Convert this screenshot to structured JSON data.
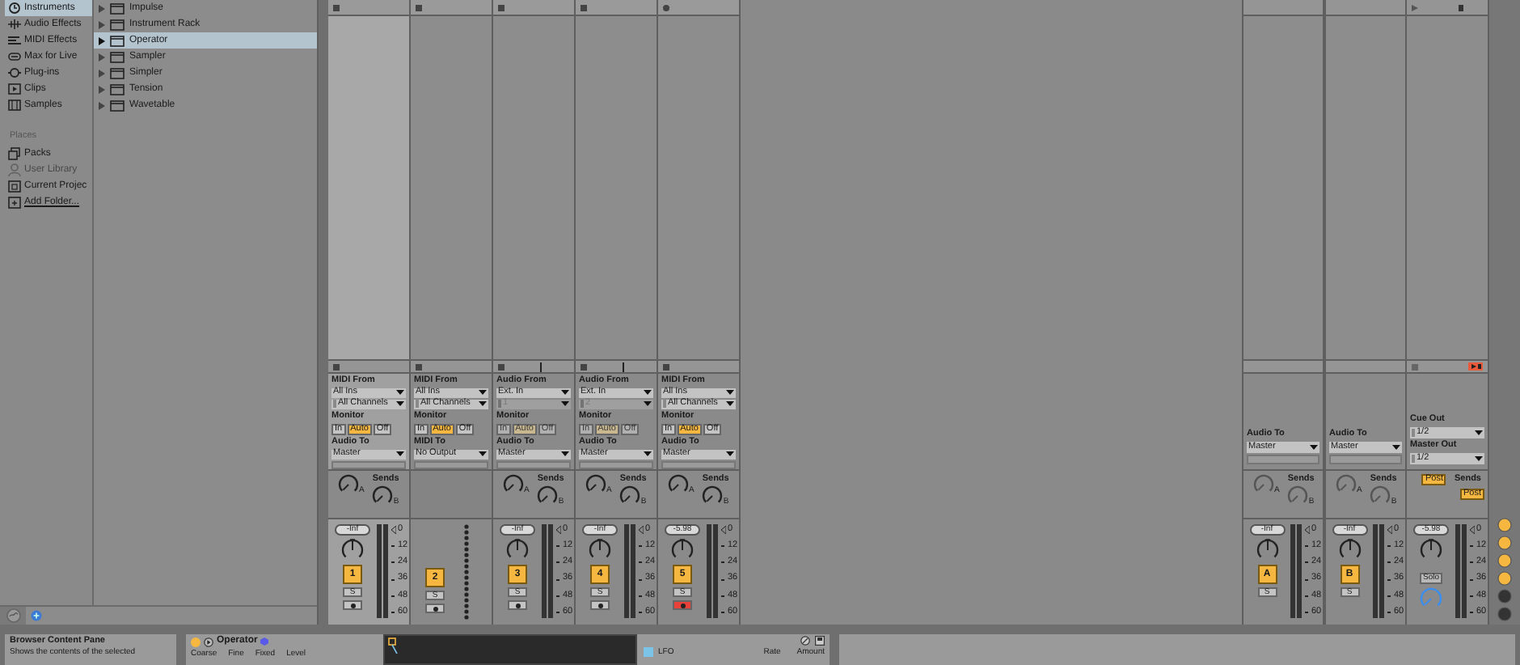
{
  "browser": {
    "categories": [
      {
        "label": "Instruments",
        "selected": true
      },
      {
        "label": "Audio Effects",
        "selected": false
      },
      {
        "label": "MIDI Effects",
        "selected": false
      },
      {
        "label": "Max for Live",
        "selected": false
      },
      {
        "label": "Plug-ins",
        "selected": false
      },
      {
        "label": "Clips",
        "selected": false
      },
      {
        "label": "Samples",
        "selected": false
      }
    ],
    "places_title": "Places",
    "places": [
      {
        "label": "Packs",
        "disabled": false
      },
      {
        "label": "User Library",
        "disabled": true
      },
      {
        "label": "Current Projec",
        "disabled": false
      },
      {
        "label": "Add Folder...",
        "disabled": false
      }
    ],
    "items": [
      {
        "label": "Impulse",
        "selected": false
      },
      {
        "label": "Instrument Rack",
        "selected": false
      },
      {
        "label": "Operator",
        "selected": true
      },
      {
        "label": "Sampler",
        "selected": false
      },
      {
        "label": "Simpler",
        "selected": false
      },
      {
        "label": "Tension",
        "selected": false
      },
      {
        "label": "Wavetable",
        "selected": false
      }
    ]
  },
  "tracks": [
    {
      "kind": "midi",
      "selected": true,
      "armed": false,
      "input_title": "MIDI From",
      "input": "All Ins",
      "channel": "All Channels",
      "channel_disabled": false,
      "monitor_title": "Monitor",
      "monitor_disabled": false,
      "monitor": [
        {
          "label": "In",
          "selected": false
        },
        {
          "label": "Auto",
          "selected": true
        },
        {
          "label": "Off",
          "selected": false
        }
      ],
      "output_title": "Audio To",
      "output": "Master",
      "sends_title": "Sends",
      "sends": [
        {
          "label": "A"
        },
        {
          "label": "B"
        }
      ],
      "volume": "-Inf",
      "number": "1",
      "solo": "S",
      "meter_scale": [
        "0",
        "12",
        "24",
        "36",
        "48",
        "60"
      ]
    },
    {
      "kind": "midi_bare",
      "selected": false,
      "armed": false,
      "input_title": "MIDI From",
      "input": "All Ins",
      "channel": "All Channels",
      "channel_disabled": false,
      "monitor_title": "Monitor",
      "monitor_disabled": false,
      "monitor": [
        {
          "label": "In",
          "selected": false
        },
        {
          "label": "Auto",
          "selected": true
        },
        {
          "label": "Off",
          "selected": false
        }
      ],
      "output_title": "MIDI To",
      "output": "No Output",
      "number": "2",
      "solo": "S"
    },
    {
      "kind": "audio",
      "selected": false,
      "armed": false,
      "input_title": "Audio From",
      "input": "Ext. In",
      "channel": "1",
      "channel_disabled": true,
      "monitor_title": "Monitor",
      "monitor_disabled": true,
      "monitor": [
        {
          "label": "In",
          "selected": false
        },
        {
          "label": "Auto",
          "selected": true
        },
        {
          "label": "Off",
          "selected": false
        }
      ],
      "output_title": "Audio To",
      "output": "Master",
      "sends_title": "Sends",
      "sends": [
        {
          "label": "A"
        },
        {
          "label": "B"
        }
      ],
      "volume": "-Inf",
      "number": "3",
      "solo": "S",
      "meter_scale": [
        "0",
        "12",
        "24",
        "36",
        "48",
        "60"
      ]
    },
    {
      "kind": "audio",
      "selected": false,
      "armed": false,
      "input_title": "Audio From",
      "input": "Ext. In",
      "channel": "2",
      "channel_disabled": true,
      "monitor_title": "Monitor",
      "monitor_disabled": true,
      "monitor": [
        {
          "label": "In",
          "selected": false
        },
        {
          "label": "Auto",
          "selected": true
        },
        {
          "label": "Off",
          "selected": false
        }
      ],
      "output_title": "Audio To",
      "output": "Master",
      "sends_title": "Sends",
      "sends": [
        {
          "label": "A"
        },
        {
          "label": "B"
        }
      ],
      "volume": "-Inf",
      "number": "4",
      "solo": "S",
      "meter_scale": [
        "0",
        "12",
        "24",
        "36",
        "48",
        "60"
      ]
    },
    {
      "kind": "midi",
      "selected": false,
      "armed": true,
      "input_title": "MIDI From",
      "input": "All Ins",
      "channel": "All Channels",
      "channel_disabled": false,
      "monitor_title": "Monitor",
      "monitor_disabled": false,
      "monitor": [
        {
          "label": "In",
          "selected": false
        },
        {
          "label": "Auto",
          "selected": true
        },
        {
          "label": "Off",
          "selected": false
        }
      ],
      "output_title": "Audio To",
      "output": "Master",
      "sends_title": "Sends",
      "sends": [
        {
          "label": "A"
        },
        {
          "label": "B"
        }
      ],
      "volume": "-5.98",
      "number": "5",
      "solo": "S",
      "meter_scale": [
        "0",
        "12",
        "24",
        "36",
        "48",
        "60"
      ]
    }
  ],
  "returns": [
    {
      "output_title": "Audio To",
      "output": "Master",
      "sends_title": "Sends",
      "sends": [
        {
          "label": "A"
        },
        {
          "label": "B"
        }
      ],
      "volume": "-Inf",
      "letter": "A",
      "solo": "S",
      "meter_scale": [
        "0",
        "12",
        "24",
        "36",
        "48",
        "60"
      ]
    },
    {
      "output_title": "Audio To",
      "output": "Master",
      "sends_title": "Sends",
      "sends": [
        {
          "label": "A"
        },
        {
          "label": "B"
        }
      ],
      "volume": "-Inf",
      "letter": "B",
      "solo": "S",
      "meter_scale": [
        "0",
        "12",
        "24",
        "36",
        "48",
        "60"
      ]
    }
  ],
  "master": {
    "cue_title": "Cue Out",
    "cue": "1/2",
    "out_title": "Master Out",
    "out": "1/2",
    "sends_title": "Sends",
    "post": [
      "Post",
      "Post"
    ],
    "volume": "-5.98",
    "solo": "Solo",
    "meter_scale": [
      "0",
      "12",
      "24",
      "36",
      "48",
      "60"
    ]
  },
  "side_toggles": [
    {
      "on": true
    },
    {
      "on": true
    },
    {
      "on": true
    },
    {
      "on": true
    },
    {
      "on": false
    },
    {
      "on": false
    }
  ],
  "info": {
    "title": "Browser Content Pane",
    "text": "Shows the contents of the selected"
  },
  "device": {
    "title": "Operator",
    "params": [
      "Coarse",
      "Fine",
      "Fixed",
      "Level"
    ],
    "lfo_label": "LFO",
    "lfo_params": [
      "Rate",
      "Amount"
    ]
  }
}
